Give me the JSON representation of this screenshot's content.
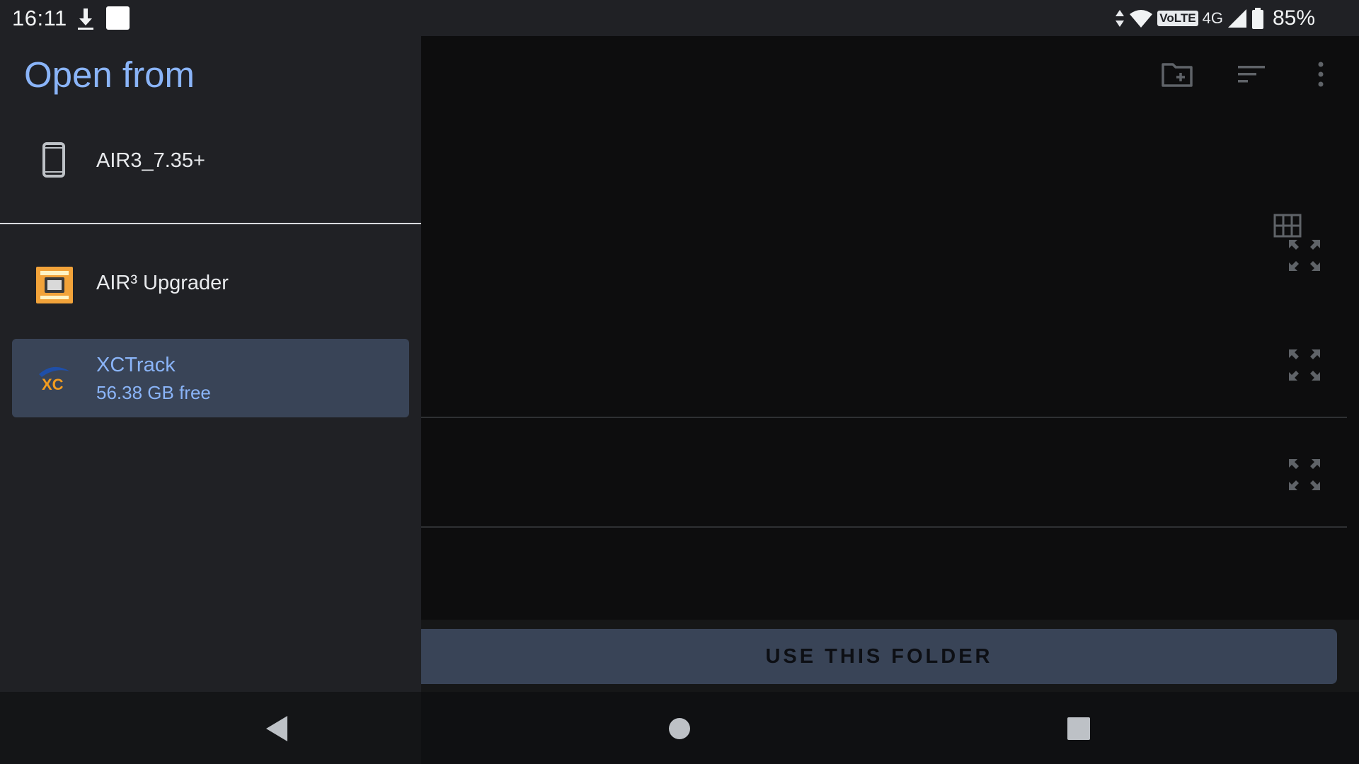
{
  "status_bar": {
    "time": "16:11",
    "volte_label": "VoLTE",
    "network_label": "4G",
    "battery_text": "85%",
    "icons": [
      "download-icon",
      "notification-square-icon",
      "data-arrows-icon",
      "wifi-icon",
      "signal-icon",
      "battery-icon"
    ]
  },
  "drawer": {
    "title": "Open from",
    "roots": [
      {
        "icon": "phone-storage-icon",
        "title": "AIR3_7.35+",
        "subtitle": ""
      },
      {
        "icon": "air3-upgrader-app-icon",
        "title": "AIR³ Upgrader",
        "subtitle": ""
      },
      {
        "icon": "xctrack-app-icon",
        "title": "XCTrack",
        "subtitle": "56.38 GB free",
        "selected": true
      }
    ]
  },
  "toolbar": {
    "icons": [
      "new-folder-icon",
      "sort-icon",
      "more-options-icon"
    ]
  },
  "main": {
    "view_toggle_icon": "grid-view-icon",
    "rows": [
      {
        "icon": "expand-icon"
      },
      {
        "icon": "expand-icon"
      },
      {
        "icon": "expand-icon"
      }
    ],
    "use_folder_label": "USE THIS FOLDER"
  },
  "nav_bar": {
    "icons": [
      "back-icon",
      "home-icon",
      "recents-icon"
    ]
  },
  "colors": {
    "accent": "#8ab4f8",
    "drawer_bg": "#202125",
    "selected_bg": "#394457",
    "main_bg": "#0d0d0e"
  }
}
